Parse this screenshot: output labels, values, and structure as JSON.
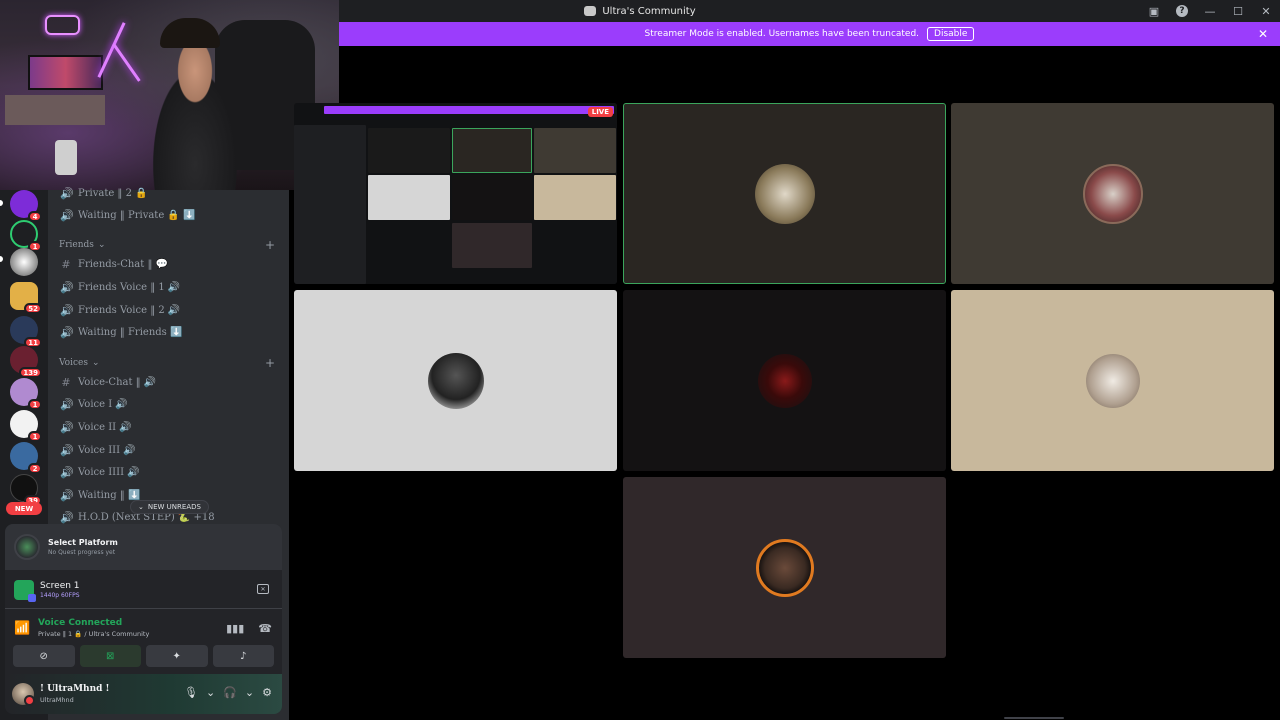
{
  "window": {
    "title": "Ultra's Community"
  },
  "banner": {
    "text": "Streamer Mode is enabled. Usernames have been truncated.",
    "disable_label": "Disable"
  },
  "servers": [
    {
      "badge": "4",
      "color": "#7d2cd8"
    },
    {
      "badge": "1",
      "color": "#1e1f22"
    },
    {
      "badge": "",
      "color": "#d8d8d8"
    },
    {
      "badge": "52",
      "color": "#e3b047"
    },
    {
      "badge": "11",
      "color": "#2a3a5a"
    },
    {
      "badge": "139",
      "color": "#6a2030"
    },
    {
      "badge": "1",
      "color": "#b08ad0"
    },
    {
      "badge": "1",
      "color": "#f2f2f2"
    },
    {
      "badge": "2",
      "color": "#3a6aa0"
    },
    {
      "badge": "39",
      "color": "#111"
    }
  ],
  "new_badge": "NEW",
  "channels": {
    "top": [
      {
        "icon": "speaker-icon",
        "glyph": "🔊",
        "label": "Private ‖ 2 🔒"
      },
      {
        "icon": "speaker-icon",
        "glyph": "🔊",
        "label": "Waiting ‖ Private 🔒 ⬇️"
      }
    ],
    "friends_category": "Friends",
    "friends": [
      {
        "icon": "hash-icon",
        "glyph": "#",
        "label": "Friends-Chat ‖ 💬"
      },
      {
        "icon": "speaker-icon",
        "glyph": "🔊",
        "label": "Friends Voice ‖ 1 🔊"
      },
      {
        "icon": "speaker-icon",
        "glyph": "🔊",
        "label": "Friends Voice ‖ 2 🔊"
      },
      {
        "icon": "speaker-icon",
        "glyph": "🔊",
        "label": "Waiting ‖ Friends ⬇️"
      }
    ],
    "voices_category": "Voices",
    "voices": [
      {
        "icon": "hash-icon",
        "glyph": "#",
        "label": "Voice-Chat ‖ 🔊"
      },
      {
        "icon": "speaker-icon",
        "glyph": "🔊",
        "label": "Voice I 🔊"
      },
      {
        "icon": "speaker-icon",
        "glyph": "🔊",
        "label": "Voice II 🔊"
      },
      {
        "icon": "speaker-icon",
        "glyph": "🔊",
        "label": "Voice III 🔊"
      },
      {
        "icon": "speaker-icon",
        "glyph": "🔊",
        "label": "Voice IIII 🔊"
      },
      {
        "icon": "speaker-icon",
        "glyph": "🔊",
        "label": "Waiting ‖ ⬇️"
      },
      {
        "icon": "speaker-icon",
        "glyph": "🔊",
        "label": "H.O.D (Next STEP) 🐍 +18"
      }
    ],
    "new_unreads": "NEW UNREADS"
  },
  "quest": {
    "title": "Select Platform",
    "subtitle": "No Quest progress yet"
  },
  "screen_share": {
    "title": "Screen 1",
    "quality": "1440p 60FPS"
  },
  "voice": {
    "status": "Voice Connected",
    "channel": "Private ‖ 1 🔒 / Ultra's Community"
  },
  "user": {
    "name": "! UltraMhnd !",
    "status": "UltraMhnd"
  },
  "stage": {
    "live_label": "LIVE",
    "tiles": [
      {
        "name": "tile-2",
        "bg": "#2a2622",
        "border": "#3ba55c",
        "avatar": "#9a8a6a"
      },
      {
        "name": "tile-3",
        "bg": "#3f3a33",
        "border": "",
        "avatar": "#6a4040"
      },
      {
        "name": "tile-4",
        "bg": "#d6d6d6",
        "border": "",
        "avatar": "#222"
      },
      {
        "name": "tile-5",
        "bg": "#141213",
        "border": "",
        "avatar": "#5a1010"
      },
      {
        "name": "tile-6",
        "bg": "#c8b89c",
        "border": "",
        "avatar": "#e8e0d4"
      },
      {
        "name": "tile-7",
        "bg": "#30282a",
        "border": "",
        "avatar": "#e07a20"
      }
    ]
  }
}
